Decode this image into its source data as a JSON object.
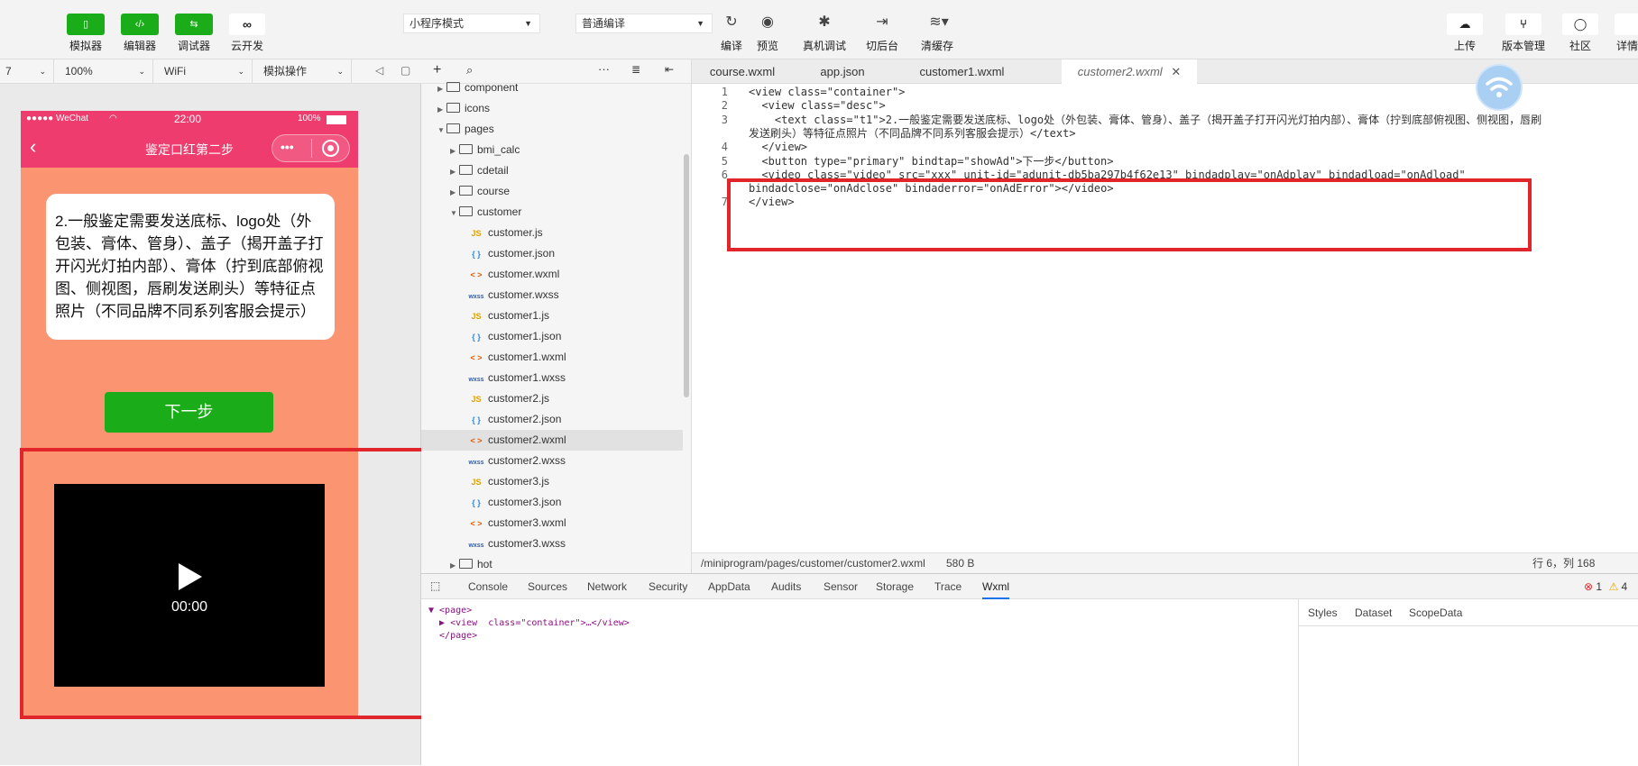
{
  "toolbar": {
    "simulator": "模拟器",
    "editor": "编辑器",
    "debugger": "调试器",
    "cloud": "云开发",
    "mode_select": "小程序模式",
    "compile_select": "普通编译",
    "compile": "编译",
    "preview": "预览",
    "remote_debug": "真机调试",
    "background": "切后台",
    "clear_cache": "清缓存",
    "upload": "上传",
    "version": "版本管理",
    "community": "社区",
    "details": "详情"
  },
  "subbar": {
    "device": "7",
    "zoom": "100%",
    "network": "WiFi",
    "operation": "模拟操作"
  },
  "phone": {
    "carrier": "●●●●● WeChat",
    "time": "22:00",
    "battery": "100%",
    "title": "鉴定口红第二步",
    "description": "2.一般鉴定需要发送底标、logo处（外包装、膏体、管身）、盖子（揭开盖子打开闪光灯拍内部）、膏体（拧到底部俯视图、侧视图，唇刷发送刷头）等特征点照片（不同品牌不同系列客服会提示）",
    "next_button": "下一步",
    "video_time": "00:00"
  },
  "tree": {
    "items": [
      {
        "name": "component",
        "kind": "folder",
        "depth": 0,
        "open": false
      },
      {
        "name": "icons",
        "kind": "folder",
        "depth": 0,
        "open": false
      },
      {
        "name": "pages",
        "kind": "folder",
        "depth": 0,
        "open": true
      },
      {
        "name": "bmi_calc",
        "kind": "folder",
        "depth": 1,
        "open": false
      },
      {
        "name": "cdetail",
        "kind": "folder",
        "depth": 1,
        "open": false
      },
      {
        "name": "course",
        "kind": "folder",
        "depth": 1,
        "open": false
      },
      {
        "name": "customer",
        "kind": "folder",
        "depth": 1,
        "open": true
      },
      {
        "name": "customer.js",
        "kind": "js",
        "depth": 2
      },
      {
        "name": "customer.json",
        "kind": "json",
        "depth": 2
      },
      {
        "name": "customer.wxml",
        "kind": "wxml",
        "depth": 2
      },
      {
        "name": "customer.wxss",
        "kind": "wxss",
        "depth": 2
      },
      {
        "name": "customer1.js",
        "kind": "js",
        "depth": 2
      },
      {
        "name": "customer1.json",
        "kind": "json",
        "depth": 2
      },
      {
        "name": "customer1.wxml",
        "kind": "wxml",
        "depth": 2
      },
      {
        "name": "customer1.wxss",
        "kind": "wxss",
        "depth": 2
      },
      {
        "name": "customer2.js",
        "kind": "js",
        "depth": 2
      },
      {
        "name": "customer2.json",
        "kind": "json",
        "depth": 2
      },
      {
        "name": "customer2.wxml",
        "kind": "wxml",
        "depth": 2,
        "selected": true
      },
      {
        "name": "customer2.wxss",
        "kind": "wxss",
        "depth": 2
      },
      {
        "name": "customer3.js",
        "kind": "js",
        "depth": 2
      },
      {
        "name": "customer3.json",
        "kind": "json",
        "depth": 2
      },
      {
        "name": "customer3.wxml",
        "kind": "wxml",
        "depth": 2
      },
      {
        "name": "customer3.wxss",
        "kind": "wxss",
        "depth": 2
      },
      {
        "name": "hot",
        "kind": "folder",
        "depth": 1,
        "open": false
      }
    ],
    "icon_labels": {
      "js": "JS",
      "json": "{ }",
      "wxml": "< >",
      "wxss": "wxss"
    }
  },
  "editor": {
    "tabs": [
      "course.wxml",
      "app.json",
      "customer1.wxml",
      "customer2.wxml"
    ],
    "active_tab": "customer2.wxml",
    "lines": [
      {
        "num": "1",
        "text": "<view class=\"container\">"
      },
      {
        "num": "2",
        "text": "  <view class=\"desc\">"
      },
      {
        "num": "3",
        "text": "    <text class=\"t1\">2.一般鉴定需要发送底标、logo处（外包装、膏体、管身）、盖子（揭开盖子打开闪光灯拍内部）、膏体（拧到底部俯视图、侧视图，唇刷"
      },
      {
        "num": "",
        "text": "发送刷头）等特征点照片（不同品牌不同系列客服会提示）</text>"
      },
      {
        "num": "4",
        "text": "  </view>"
      },
      {
        "num": "5",
        "text": "  <button type=\"primary\" bindtap=\"showAd\">下一步</button>"
      },
      {
        "num": "6",
        "text": "  <video class=\"video\" src=\"xxx\" unit-id=\"adunit-db5ba297b4f62e13\" bindadplay=\"onAdplay\" bindadload=\"onAdload\""
      },
      {
        "num": "",
        "text": "bindadclose=\"onAdclose\" bindaderror=\"onAdError\"></video>"
      },
      {
        "num": "7",
        "text": "</view>"
      }
    ],
    "status_path": "/miniprogram/pages/customer/customer2.wxml",
    "status_size": "580 B",
    "status_cursor": "行 6，列 168"
  },
  "devtools": {
    "tabs": [
      "Console",
      "Sources",
      "Network",
      "Security",
      "AppData",
      "Audits",
      "Sensor",
      "Storage",
      "Trace",
      "Wxml"
    ],
    "active_tab": "Wxml",
    "errors": "1",
    "warnings": "4",
    "xml": [
      "▼ <page>",
      "  ▶ <view  class=\"container\">…</view>",
      "  </page>"
    ],
    "side_tabs": [
      "Styles",
      "Dataset",
      "ScopeData"
    ]
  },
  "colors": {
    "accent_green": "#1aad19",
    "nav_pink": "#ef3c6e",
    "page_bg": "#fb9470",
    "highlight_red": "#e0262b"
  }
}
